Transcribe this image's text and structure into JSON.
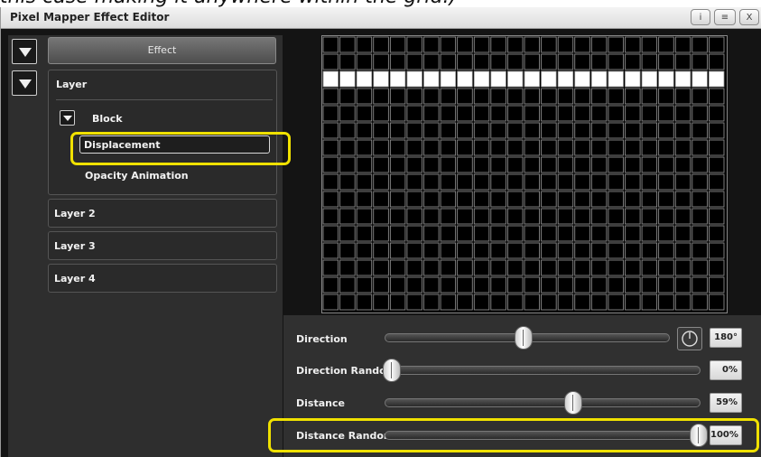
{
  "caption": "this case making it anywhere within the grid.)",
  "window": {
    "title": "Pixel Mapper Effect Editor",
    "buttons": [
      "i",
      "≡",
      "X"
    ]
  },
  "tree": {
    "effect_label": "Effect",
    "layer1": "Layer",
    "block": "Block",
    "displacement": "Displacement",
    "opacity_animation": "Opacity Animation",
    "layer2": "Layer 2",
    "layer3": "Layer 3",
    "layer4": "Layer 4"
  },
  "grid": {
    "cols": 24,
    "rows": 16,
    "lit_row": 2,
    "lit_color": "#ffffff",
    "cell_color": "#000000",
    "line_color": "#9a9a9a"
  },
  "settings": {
    "direction": {
      "label": "Direction",
      "value": "180°",
      "fraction": 0.43
    },
    "direction_random": {
      "label": "Direction Random",
      "value": "0%",
      "fraction": 0.0
    },
    "distance": {
      "label": "Distance",
      "value": "59%",
      "fraction": 0.59
    },
    "distance_random": {
      "label": "Distance Random",
      "value": "100%",
      "fraction": 1.0
    }
  },
  "colors": {
    "highlight": "#f0e100",
    "panel": "#2e2e2e",
    "background": "#141414"
  }
}
